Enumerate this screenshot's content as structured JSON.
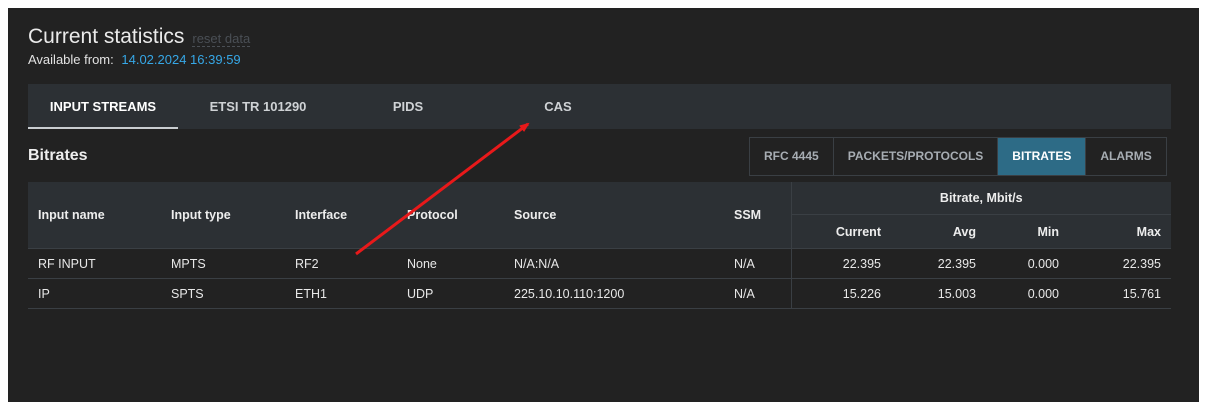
{
  "header": {
    "title": "Current statistics",
    "reset_label": "reset data",
    "available_label": "Available from:",
    "available_date": "14.02.2024 16:39:59"
  },
  "tabs": [
    {
      "label": "INPUT STREAMS",
      "active": true
    },
    {
      "label": "ETSI TR 101290",
      "active": false
    },
    {
      "label": "PIDS",
      "active": false
    },
    {
      "label": "CAS",
      "active": false
    }
  ],
  "section": {
    "title": "Bitrates",
    "subtabs": [
      {
        "label": "RFC 4445",
        "active": false
      },
      {
        "label": "PACKETS/PROTOCOLS",
        "active": false
      },
      {
        "label": "BITRATES",
        "active": true
      },
      {
        "label": "ALARMS",
        "active": false
      }
    ]
  },
  "table": {
    "headers": {
      "input_name": "Input name",
      "input_type": "Input type",
      "interface": "Interface",
      "protocol": "Protocol",
      "source": "Source",
      "ssm": "SSM",
      "bitrate_group": "Bitrate, Mbit/s",
      "current": "Current",
      "avg": "Avg",
      "min": "Min",
      "max": "Max"
    },
    "rows": [
      {
        "input_name": "RF INPUT",
        "input_type": "MPTS",
        "interface": "RF2",
        "protocol": "None",
        "source": "N/A:N/A",
        "ssm": "N/A",
        "current": "22.395",
        "avg": "22.395",
        "min": "0.000",
        "max": "22.395"
      },
      {
        "input_name": "IP",
        "input_type": "SPTS",
        "interface": "ETH1",
        "protocol": "UDP",
        "source": "225.10.10.110:1200",
        "ssm": "N/A",
        "current": "15.226",
        "avg": "15.003",
        "min": "0.000",
        "max": "15.761"
      }
    ]
  },
  "annotation": {
    "arrow_color": "#e8191a"
  }
}
